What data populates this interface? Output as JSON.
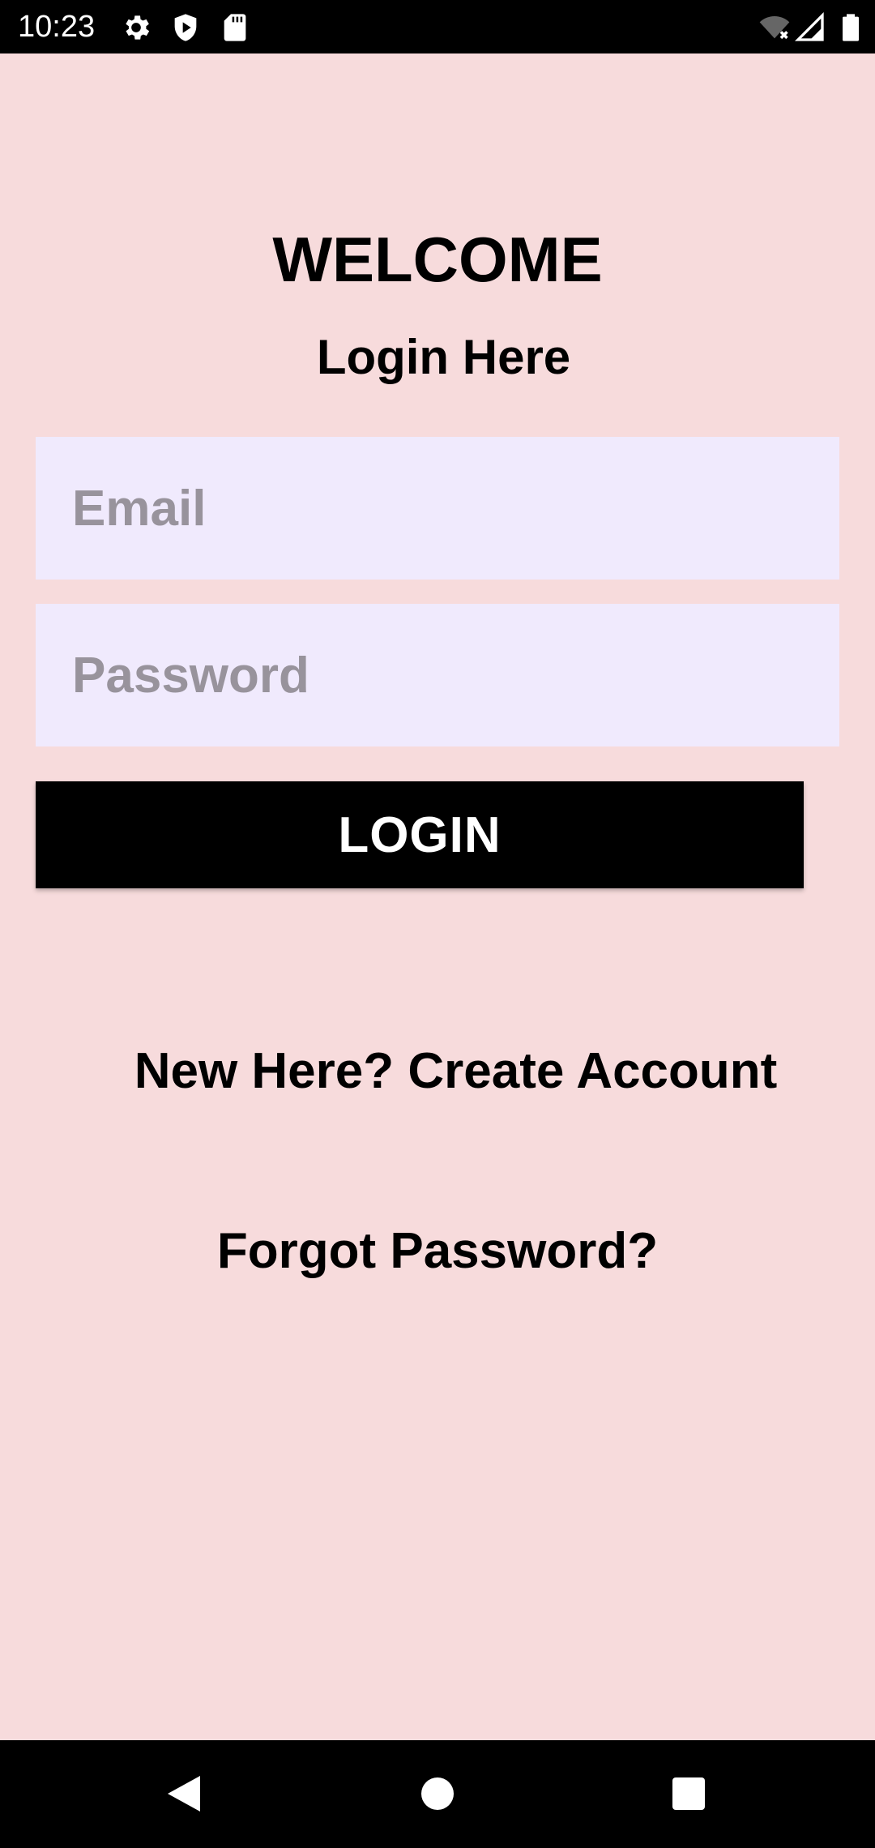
{
  "status_bar": {
    "time": "10:23",
    "icons": [
      "gear-icon",
      "shield-play-icon",
      "sd-card-icon",
      "wifi-off-icon",
      "cell-signal-icon",
      "battery-icon"
    ]
  },
  "main": {
    "title": "WELCOME",
    "subtitle": "Login Here",
    "email": {
      "placeholder": "Email",
      "value": ""
    },
    "password": {
      "placeholder": "Password",
      "value": ""
    },
    "login_label": "LOGIN",
    "create_account_label": "New Here? Create Account",
    "forgot_password_label": "Forgot Password?"
  },
  "nav_bar": {
    "icons": [
      "back-icon",
      "home-icon",
      "recents-icon"
    ]
  },
  "colors": {
    "background": "#f7dbdc",
    "field_background": "#f0eafd",
    "placeholder": "#98939c",
    "button": "#000000",
    "button_text": "#ffffff"
  }
}
